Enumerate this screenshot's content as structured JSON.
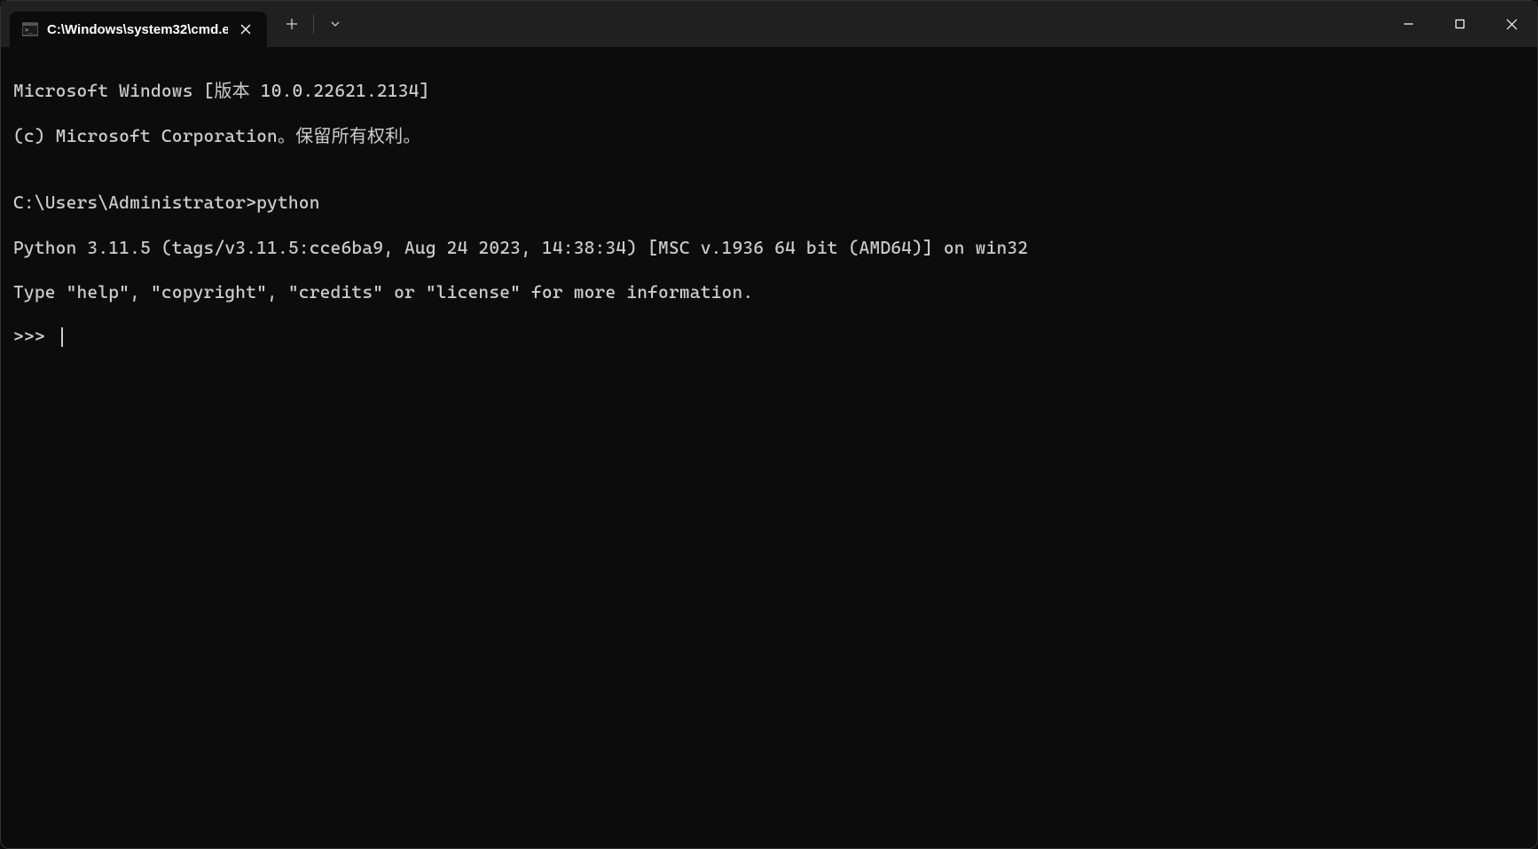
{
  "tab": {
    "title": "C:\\Windows\\system32\\cmd.e",
    "icon": "cmd-icon"
  },
  "terminal": {
    "lines": [
      "Microsoft Windows [版本 10.0.22621.2134]",
      "(c) Microsoft Corporation。保留所有权利。",
      "",
      "C:\\Users\\Administrator>python",
      "Python 3.11.5 (tags/v3.11.5:cce6ba9, Aug 24 2023, 14:38:34) [MSC v.1936 64 bit (AMD64)] on win32",
      "Type \"help\", \"copyright\", \"credits\" or \"license\" for more information."
    ],
    "prompt": ">>> "
  }
}
